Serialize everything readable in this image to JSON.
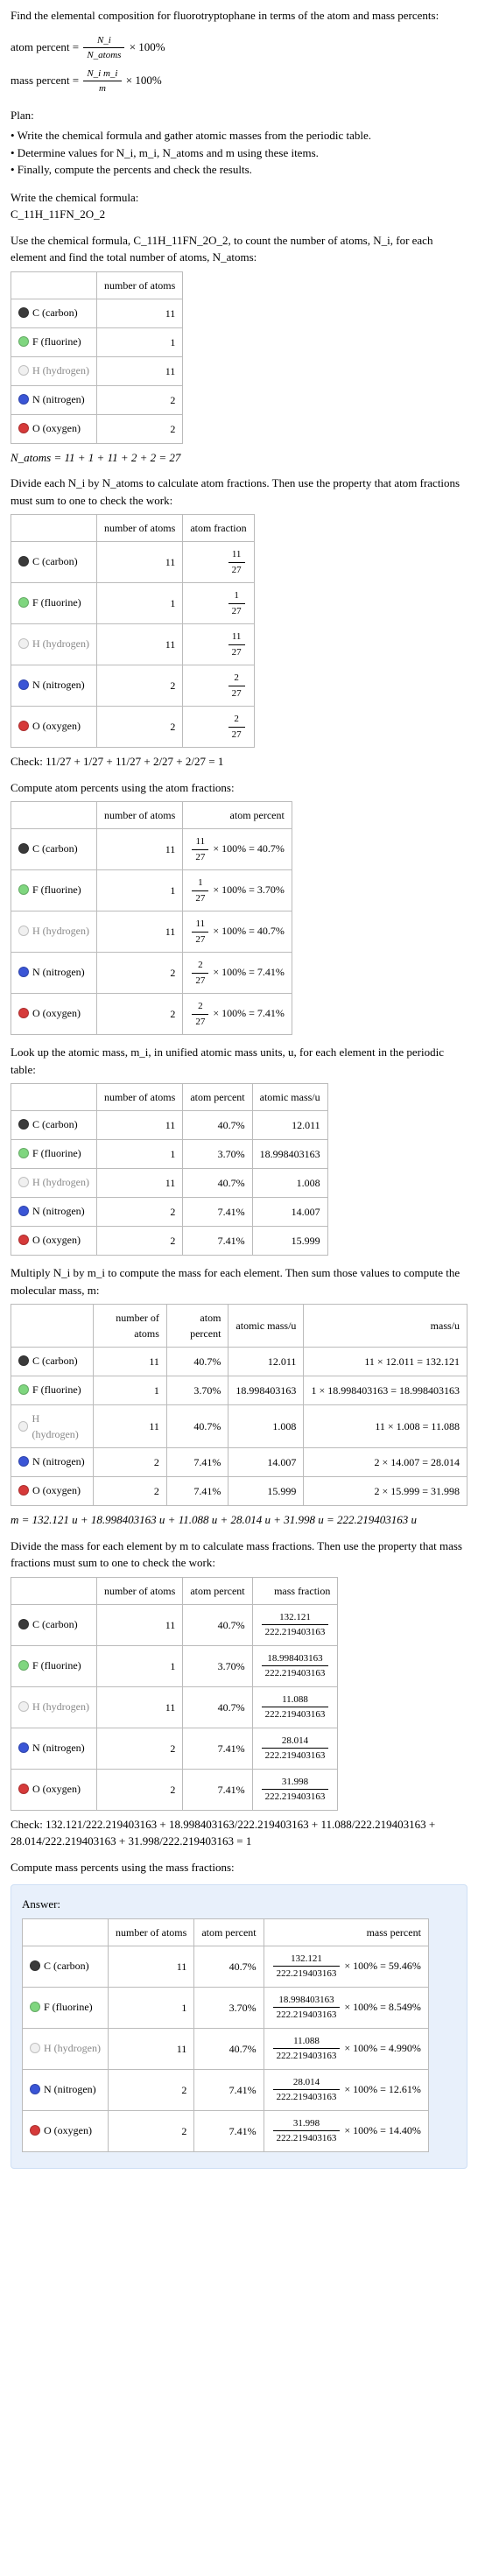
{
  "intro": {
    "prompt": "Find the elemental composition for fluorotryptophane in terms of the atom and mass percents:",
    "ap_label": "atom percent =",
    "ap_eq_n": "N_i",
    "ap_eq_d": "N_atoms",
    "mp_label": "mass percent =",
    "mp_eq_n": "N_i m_i",
    "mp_eq_d": "m",
    "pct": "× 100%"
  },
  "plan": {
    "t": "Plan:",
    "b1": "• Write the chemical formula and gather atomic masses from the periodic table.",
    "b2": "• Determine values for N_i, m_i, N_atoms and m using these items.",
    "b3": "• Finally, compute the percents and check the results."
  },
  "s1": {
    "t": "Write the chemical formula:",
    "f": "C_11H_11FN_2O_2"
  },
  "s2": {
    "t": "Use the chemical formula, C_11H_11FN_2O_2, to count the number of atoms, N_i, for each element and find the total number of atoms, N_atoms:",
    "h1": "",
    "h2": "number of atoms",
    "rows": [
      [
        "C (carbon)",
        "11"
      ],
      [
        "F (fluorine)",
        "1"
      ],
      [
        "H (hydrogen)",
        "11"
      ],
      [
        "N (nitrogen)",
        "2"
      ],
      [
        "O (oxygen)",
        "2"
      ]
    ],
    "sum": "N_atoms = 11 + 1 + 11 + 2 + 2 = 27"
  },
  "s3": {
    "t": "Divide each N_i by N_atoms to calculate atom fractions. Then use the property that atom fractions must sum to one to check the work:",
    "h3": "atom fraction",
    "f": [
      [
        "11",
        "27"
      ],
      [
        "1",
        "27"
      ],
      [
        "11",
        "27"
      ],
      [
        "2",
        "27"
      ],
      [
        "2",
        "27"
      ]
    ],
    "chk": "Check: 11/27 + 1/27 + 11/27 + 2/27 + 2/27 = 1"
  },
  "s4": {
    "t": "Compute atom percents using the atom fractions:",
    "h3": "atom percent",
    "p": [
      [
        "11",
        "27",
        "× 100% = 40.7%"
      ],
      [
        "1",
        "27",
        "× 100% = 3.70%"
      ],
      [
        "11",
        "27",
        "× 100% = 40.7%"
      ],
      [
        "2",
        "27",
        "× 100% = 7.41%"
      ],
      [
        "2",
        "27",
        "× 100% = 7.41%"
      ]
    ]
  },
  "s5": {
    "t": "Look up the atomic mass, m_i, in unified atomic mass units, u, for each element in the periodic table:",
    "h3": "atom percent",
    "h4": "atomic mass/u",
    "rows": [
      [
        "11",
        "40.7%",
        "12.011"
      ],
      [
        "1",
        "3.70%",
        "18.998403163"
      ],
      [
        "11",
        "40.7%",
        "1.008"
      ],
      [
        "2",
        "7.41%",
        "14.007"
      ],
      [
        "2",
        "7.41%",
        "15.999"
      ]
    ]
  },
  "s6": {
    "t": "Multiply N_i by m_i to compute the mass for each element. Then sum those values to compute the molecular mass, m:",
    "h5": "mass/u",
    "m": [
      "11 × 12.011 = 132.121",
      "1 × 18.998403163 = 18.998403163",
      "11 × 1.008 = 11.088",
      "2 × 14.007 = 28.014",
      "2 × 15.999 = 31.998"
    ],
    "sum": "m = 132.121 u + 18.998403163 u + 11.088 u + 28.014 u + 31.998 u = 222.219403163 u"
  },
  "s7": {
    "t": "Divide the mass for each element by m to calculate mass fractions. Then use the property that mass fractions must sum to one to check the work:",
    "h3": "mass fraction",
    "f": [
      [
        "132.121",
        "222.219403163"
      ],
      [
        "18.998403163",
        "222.219403163"
      ],
      [
        "11.088",
        "222.219403163"
      ],
      [
        "28.014",
        "222.219403163"
      ],
      [
        "31.998",
        "222.219403163"
      ]
    ],
    "chk": "Check: 132.121/222.219403163 + 18.998403163/222.219403163 + 11.088/222.219403163 + 28.014/222.219403163 + 31.998/222.219403163 = 1"
  },
  "s8": {
    "t": "Compute mass percents using the mass fractions:",
    "ans": "Answer:",
    "h3": "mass percent",
    "p": [
      [
        "132.121",
        "222.219403163",
        "× 100% = 59.46%"
      ],
      [
        "18.998403163",
        "222.219403163",
        "× 100% = 8.549%"
      ],
      [
        "11.088",
        "222.219403163",
        "× 100% = 4.990%"
      ],
      [
        "28.014",
        "222.219403163",
        "× 100% = 12.61%"
      ],
      [
        "31.998",
        "222.219403163",
        "× 100% = 14.40%"
      ]
    ]
  },
  "el": [
    [
      "C",
      "C (carbon)",
      "c-C",
      ""
    ],
    [
      "F",
      "F (fluorine)",
      "c-F",
      ""
    ],
    [
      "H",
      "H (hydrogen)",
      "c-H",
      "light"
    ],
    [
      "N",
      "N (nitrogen)",
      "c-N",
      ""
    ],
    [
      "O",
      "O (oxygen)",
      "c-O",
      ""
    ]
  ],
  "h_num": "number of atoms",
  "h_ap": "atom percent",
  "h_am": "atomic mass/u"
}
